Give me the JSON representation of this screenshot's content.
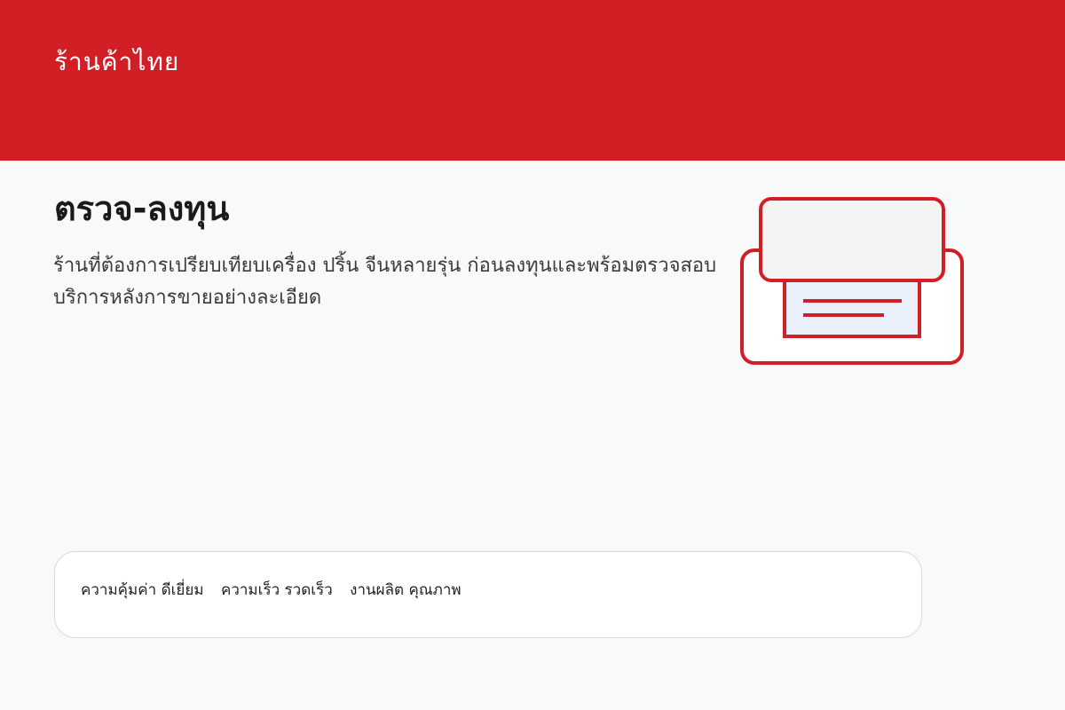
{
  "header": {
    "brand": "ร้านค้าไทย"
  },
  "main": {
    "title": "ตรวจ-ลงทุน",
    "description": "ร้านที่ต้องการเปรียบเทียบเครื่อง ปริ้น จีนหลายรุ่น ก่อนลงทุนและพร้อมตรวจสอบบริการหลังการขายอย่างละเอียด"
  },
  "illustration": {
    "icon": "printer-icon",
    "accent": "#d21f26",
    "paper_color": "#eaf1fc",
    "body_fill": "#ffffff",
    "top_fill": "#f4f4f4"
  },
  "stats": [
    {
      "label": "ความคุ้มค่า",
      "value": "ดีเยี่ยม"
    },
    {
      "label": "ความเร็ว",
      "value": "รวดเร็ว"
    },
    {
      "label": "งานผลิต",
      "value": "คุณภาพ"
    }
  ],
  "colors": {
    "brand": "#d21f26",
    "background": "#f8f9fb",
    "card_border": "#d9d9d9"
  }
}
